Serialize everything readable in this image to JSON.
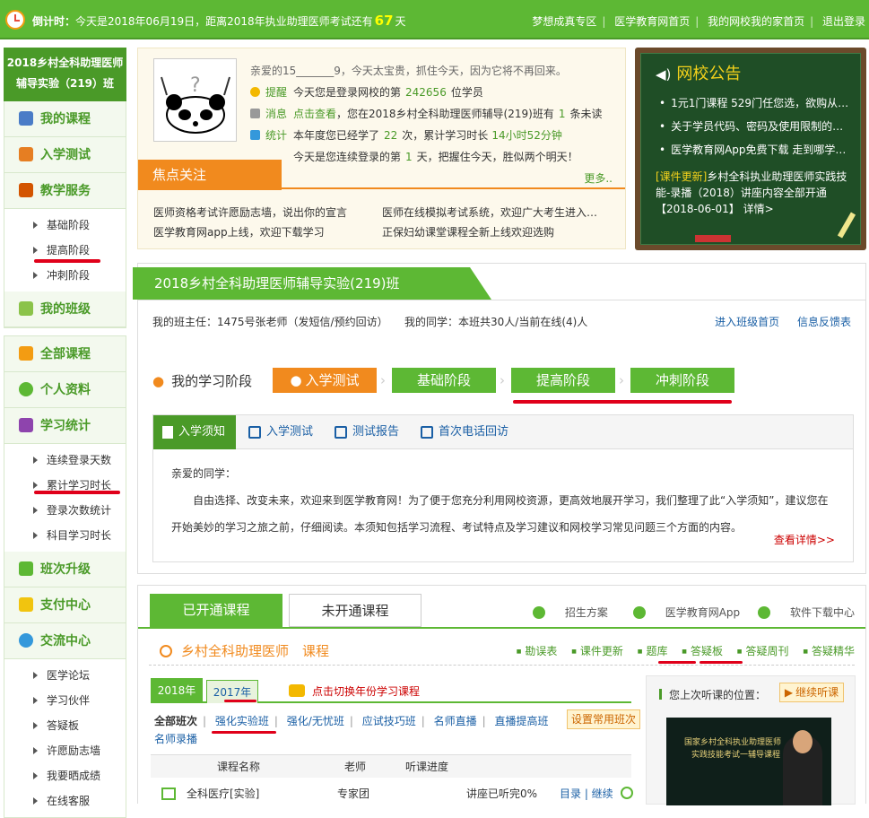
{
  "topbar": {
    "countdown_label": "倒计时：",
    "countdown_text": "今天是2018年06月19日，距离2018年执业助理医师考试还有",
    "countdown_days": "67",
    "countdown_unit": "天",
    "links": [
      "梦想成真专区",
      "医学教育网首页",
      "我的网校我的家首页",
      "退出登录"
    ]
  },
  "sidebar": {
    "class_title": "2018乡村全科助理医师辅导实验（219）班",
    "group1": [
      {
        "label": "我的课程",
        "color": "#4a7cc7"
      },
      {
        "label": "入学测试",
        "color": "#e67e22"
      },
      {
        "label": "教学服务",
        "color": "#d35400"
      }
    ],
    "teaching_subs": [
      "基础阶段",
      "提高阶段",
      "冲刺阶段"
    ],
    "my_class": "我的班级",
    "group2": [
      {
        "label": "全部课程",
        "color": "#f39c12"
      },
      {
        "label": "个人资料",
        "color": "#5db834"
      },
      {
        "label": "学习统计",
        "color": "#8e44ad"
      }
    ],
    "stats_subs": [
      "连续登录天数",
      "累计学习时长",
      "登录次数统计",
      "科目学习时长"
    ],
    "group3": [
      {
        "label": "班次升级",
        "color": "#5db834"
      },
      {
        "label": "支付中心",
        "color": "#f1c40f"
      },
      {
        "label": "交流中心",
        "color": "#3498db"
      }
    ],
    "comm_subs": [
      "医学论坛",
      "学习伙伴",
      "答疑板",
      "许愿励志墙",
      "我要晒成绩",
      "在线客服"
    ]
  },
  "welcome": {
    "greeting": "亲爱的15_______9，今天太宝贵，抓住今天，因为它将不再回来。",
    "remind_label": "提醒",
    "remind_text_a": "今天您是登录网校的第",
    "remind_num": "242656",
    "remind_text_b": "位学员",
    "msg_label": "消息",
    "msg_link": "点击查看",
    "msg_text_a": "，您在2018乡村全科助理医师辅导(219)班有",
    "msg_num": "1",
    "msg_text_b": "条未读",
    "stat_label": "统计",
    "stat_text_a": "本年度您已经学了",
    "stat_num": "22",
    "stat_text_b": "次，累计学习时长",
    "stat_time": "14小时52分钟",
    "stat_text_c": "今天是您连续登录的第",
    "stat_days": "1",
    "stat_text_d": "天，把握住今天，胜似两个明天！",
    "focus_title": "焦点关注",
    "more": "更多..",
    "news": [
      "医师资格考试许愿励志墙，说出你的宣言",
      "医学教育网app上线，欢迎下载学习",
      "医师在线模拟考试系统，欢迎广大考生进入…",
      "正保妇幼课堂课程全新上线欢迎选购"
    ]
  },
  "board": {
    "title": "网校公告",
    "items": [
      "1元1门课程 529门任您选，欲购从…",
      "关于学员代码、密码及使用限制的…",
      "医学教育网App免费下载 走到哪学…"
    ],
    "note_tag": "[课件更新]",
    "note_text": "乡村全科执业助理医师实践技能-录播（2018）讲座内容全部开通",
    "note_date": "【2018-06-01】",
    "note_link": "详情>"
  },
  "class": {
    "title": "2018乡村全科助理医师辅导实验(219)班",
    "teacher": "我的班主任：1475号张老师（发短信/预约回访）",
    "classmates": "我的同学：本班共30人/当前在线(4)人",
    "links": [
      "进入班级首页",
      "信息反馈表"
    ],
    "stage_label": "我的学习阶段",
    "stages": [
      "入学测试",
      "基础阶段",
      "提高阶段",
      "冲刺阶段"
    ],
    "tabs": [
      "入学须知",
      "入学测试",
      "测试报告",
      "首次电话回访"
    ],
    "body_greeting": "亲爱的同学：",
    "body_text": "自由选择、改变未来，欢迎来到医学教育网！为了便于您充分利用网校资源，更高效地展开学习，我们整理了此“入学须知”，建议您在开始美妙的学习之旅之前，仔细阅读。本须知包括学习流程、考试特点及学习建议和网校学习常见问题三个方面的内容。",
    "detail": "查看详情>>"
  },
  "courses": {
    "tab_open": "已开通课程",
    "tab_closed": "未开通课程",
    "links": [
      "招生方案",
      "医学教育网App",
      "软件下载中心"
    ],
    "title": "乡村全科助理医师　课程",
    "right_links": [
      "勘误表",
      "课件更新",
      "题库",
      "答疑板",
      "答疑周刊",
      "答疑精华"
    ],
    "years": [
      "2018年",
      "2017年"
    ],
    "year_hint": "点击切换年份学习课程",
    "filters": [
      "全部班次",
      "强化实验班",
      "强化/无忧班",
      "应试技巧班",
      "名师直播",
      "直播提高班",
      "名师录播"
    ],
    "set_button": "设置常用班次",
    "table_headers": [
      "课程名称",
      "老师",
      "听课进度"
    ],
    "row": {
      "name": "全科医疗[实验]",
      "teacher": "专家团",
      "progress": "讲座已听完0%",
      "actions": "目录 | 继续"
    },
    "last_title": "您上次听课的位置：",
    "continue": "继续听课",
    "video_line1": "国家乡村全科执业助理医师",
    "video_line2": "实践技能考试一辅导课程"
  }
}
